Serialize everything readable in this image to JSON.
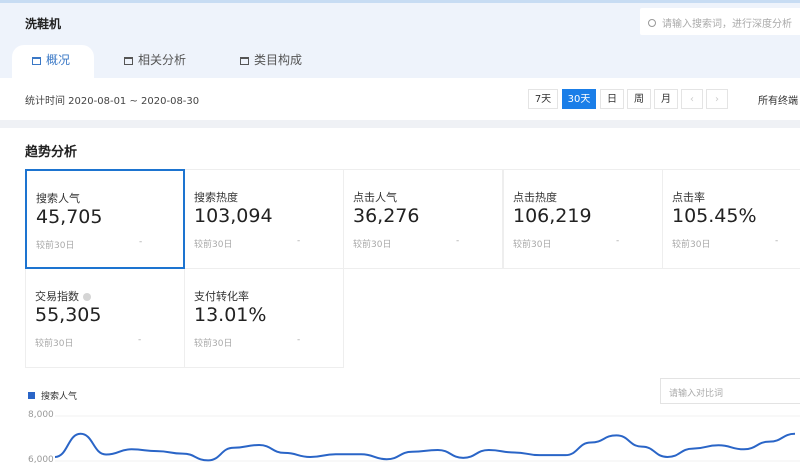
{
  "header": {
    "title": "洗鞋机",
    "search_placeholder": "请输入搜索词，进行深度分析",
    "search_icon": "search-icon"
  },
  "tabs": [
    {
      "label": "概况",
      "active": true
    },
    {
      "label": "相关分析",
      "active": false
    },
    {
      "label": "类目构成",
      "active": false
    }
  ],
  "daterow": {
    "range": "统计时间 2020-08-01 ~ 2020-08-30",
    "buttons": [
      "7天",
      "30天",
      "日",
      "周",
      "月"
    ],
    "selected": "30天",
    "prev": "‹",
    "next": "›",
    "all_trends": "所有终端"
  },
  "section_title": "趋势分析",
  "metrics": [
    {
      "label": "搜索人气",
      "value": "45,705",
      "compare": "较前30日",
      "change": "-",
      "selected": true
    },
    {
      "label": "搜索热度",
      "value": "103,094",
      "compare": "较前30日",
      "change": "-"
    },
    {
      "label": "点击人气",
      "value": "36,276",
      "compare": "较前30日",
      "change": "-"
    },
    {
      "label": "点击热度",
      "value": "106,219",
      "compare": "较前30日",
      "change": "-"
    },
    {
      "label": "点击率",
      "value": "105.45%",
      "compare": "较前30日",
      "change": "-"
    },
    {
      "label": "交易指数",
      "value": "55,305",
      "compare": "较前30日",
      "change": "-",
      "info_icon": true
    },
    {
      "label": "支付转化率",
      "value": "13.01%",
      "compare": "较前30日",
      "change": "-"
    }
  ],
  "compare_input_placeholder": "请输入对比词",
  "chart_data": {
    "type": "line",
    "series": [
      {
        "name": "搜索人气",
        "color": "#2a65c7",
        "values": [
          6180,
          7210,
          6290,
          6520,
          6440,
          6330,
          6030,
          6590,
          6710,
          6360,
          6180,
          6300,
          6300,
          6080,
          6410,
          6490,
          6140,
          6490,
          6380,
          6260,
          6260,
          6820,
          7140,
          6640,
          6180,
          6550,
          6700,
          6520,
          6860,
          7210
        ]
      }
    ],
    "y_ticks": [
      "8,000",
      "6,000"
    ],
    "ylim_visible": [
      6000,
      8000
    ],
    "grid": true,
    "legend": "top-left"
  }
}
